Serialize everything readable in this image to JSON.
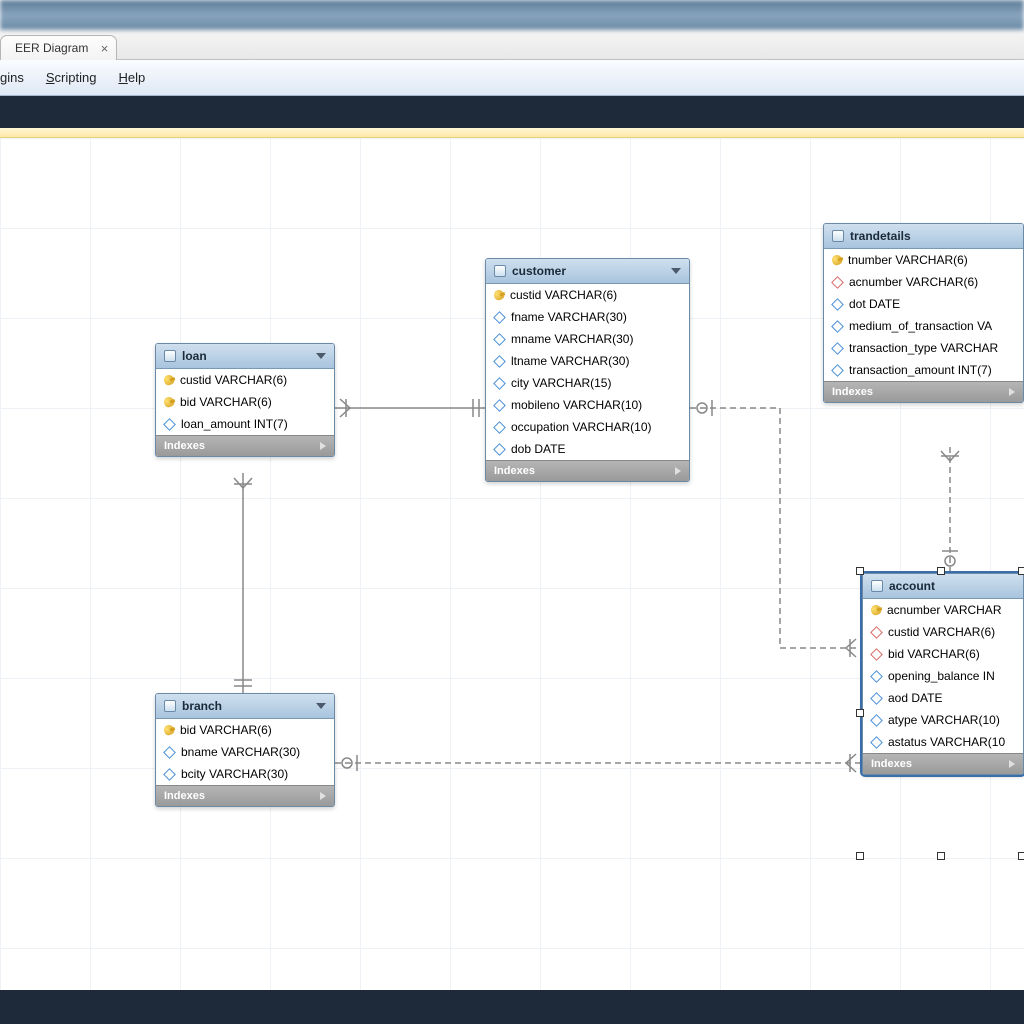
{
  "tab": {
    "title": "EER Diagram"
  },
  "menu": {
    "plugins": "gins",
    "scripting": "Scripting",
    "help": "Help"
  },
  "indexes_label": "Indexes",
  "entities": {
    "loan": {
      "title": "loan",
      "cols": [
        {
          "icon": "key",
          "text": "custid VARCHAR(6)"
        },
        {
          "icon": "key",
          "text": "bid VARCHAR(6)"
        },
        {
          "icon": "dia",
          "text": "loan_amount INT(7)"
        }
      ]
    },
    "customer": {
      "title": "customer",
      "cols": [
        {
          "icon": "key",
          "text": "custid VARCHAR(6)"
        },
        {
          "icon": "dia",
          "text": "fname VARCHAR(30)"
        },
        {
          "icon": "dia",
          "text": "mname VARCHAR(30)"
        },
        {
          "icon": "dia",
          "text": "ltname VARCHAR(30)"
        },
        {
          "icon": "dia",
          "text": "city VARCHAR(15)"
        },
        {
          "icon": "dia",
          "text": "mobileno VARCHAR(10)"
        },
        {
          "icon": "dia",
          "text": "occupation VARCHAR(10)"
        },
        {
          "icon": "dia",
          "text": "dob DATE"
        }
      ]
    },
    "trandetails": {
      "title": "trandetails",
      "cols": [
        {
          "icon": "key",
          "text": "tnumber VARCHAR(6)"
        },
        {
          "icon": "diao",
          "text": "acnumber VARCHAR(6)"
        },
        {
          "icon": "dia",
          "text": "dot DATE"
        },
        {
          "icon": "dia",
          "text": "medium_of_transaction VA"
        },
        {
          "icon": "dia",
          "text": "transaction_type VARCHAR"
        },
        {
          "icon": "dia",
          "text": "transaction_amount INT(7)"
        }
      ]
    },
    "branch": {
      "title": "branch",
      "cols": [
        {
          "icon": "key",
          "text": "bid VARCHAR(6)"
        },
        {
          "icon": "dia",
          "text": "bname VARCHAR(30)"
        },
        {
          "icon": "dia",
          "text": "bcity VARCHAR(30)"
        }
      ]
    },
    "account": {
      "title": "account",
      "cols": [
        {
          "icon": "key",
          "text": "acnumber VARCHAR"
        },
        {
          "icon": "diao",
          "text": "custid VARCHAR(6)"
        },
        {
          "icon": "diao",
          "text": "bid VARCHAR(6)"
        },
        {
          "icon": "dia",
          "text": "opening_balance IN"
        },
        {
          "icon": "dia",
          "text": "aod DATE"
        },
        {
          "icon": "dia",
          "text": "atype VARCHAR(10)"
        },
        {
          "icon": "dia",
          "text": "astatus VARCHAR(10"
        }
      ]
    }
  }
}
